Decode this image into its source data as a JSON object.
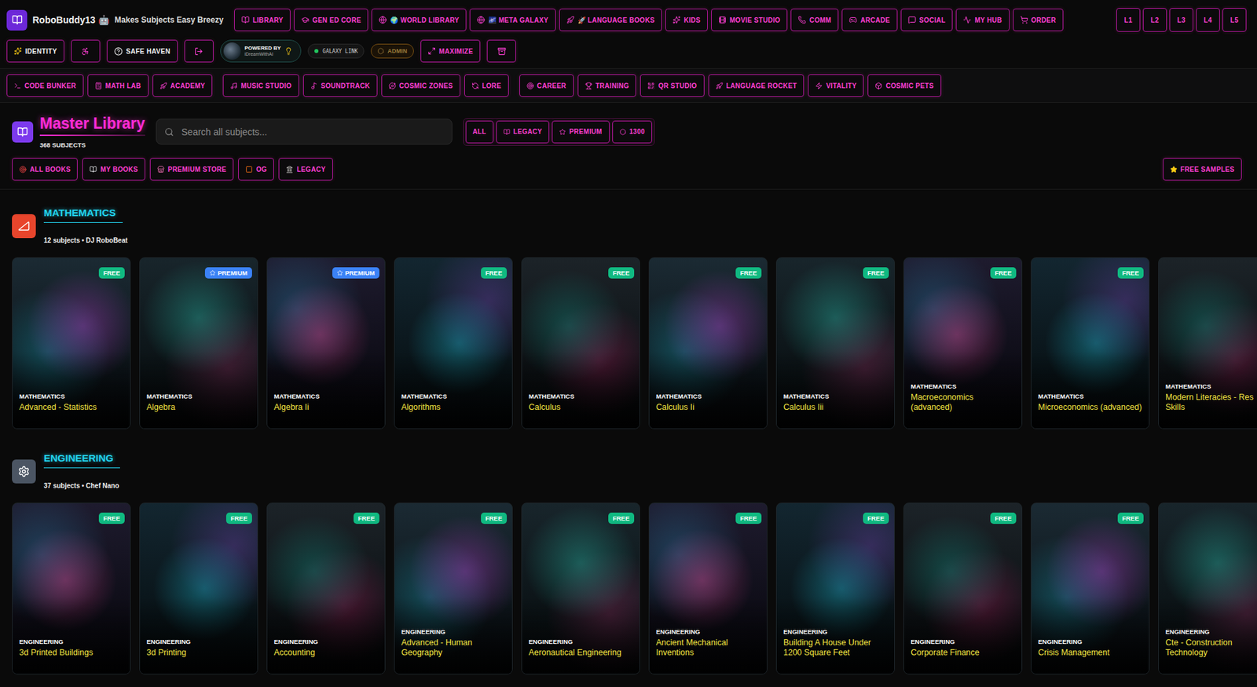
{
  "header": {
    "brand": "RoboBuddy13 🤖",
    "tagline": "Makes Subjects Easy Breezy",
    "nav": [
      {
        "label": "LIBRARY",
        "selected": false
      },
      {
        "label": "GEN ED CORE",
        "selected": false
      },
      {
        "label": "🌍 WORLD LIBRARY",
        "selected": false
      },
      {
        "label": "🌌 META GALAXY",
        "selected": false
      },
      {
        "label": "🚀 LANGUAGE BOOKS",
        "selected": false
      },
      {
        "label": "KIDS",
        "selected": false
      },
      {
        "label": "MOVIE STUDIO",
        "selected": false
      },
      {
        "label": "COMM",
        "selected": false
      },
      {
        "label": "ARCADE",
        "selected": false
      },
      {
        "label": "SOCIAL",
        "selected": false
      },
      {
        "label": "MY HUB",
        "selected": false
      },
      {
        "label": "ORDER",
        "selected": false
      }
    ],
    "levels": [
      "L1",
      "L2",
      "L3",
      "L4",
      "L5"
    ]
  },
  "toolbar": {
    "identity": "IDENTITY",
    "safe_haven": "SAFE HAVEN",
    "powered_by": "POWERED BY",
    "powered_name": "iDreamWithAI",
    "galaxy_link": "GALAXY LINK",
    "admin": {
      "label": "ADMIN",
      "disabled": true
    },
    "maximize": "MAXIMIZE"
  },
  "tools": [
    [
      "CODE BUNKER",
      "MATH LAB",
      "ACADEMY"
    ],
    [
      "MUSIC STUDIO",
      "SOUNDTRACK",
      "COSMIC ZONES",
      "LORE"
    ],
    [
      "CAREER",
      "TRAINING",
      "QR STUDIO",
      "LANGUAGE ROCKET",
      "VITALITY",
      "COSMIC PETS"
    ]
  ],
  "library": {
    "title": "Master Library",
    "count": "368 SUBJECTS",
    "search_placeholder": "Search all subjects...",
    "filters": [
      {
        "label": "ALL",
        "selected": false
      },
      {
        "label": "LEGACY",
        "selected": false
      },
      {
        "label": "PREMIUM",
        "selected": false
      },
      {
        "label": "1300",
        "selected": false
      }
    ],
    "book_tabs": [
      {
        "label": "ALL BOOKS",
        "selected": false
      },
      {
        "label": "MY BOOKS",
        "selected": false
      },
      {
        "label": "PREMIUM STORE",
        "selected": false
      },
      {
        "label": "OG",
        "selected": false
      },
      {
        "label": "LEGACY",
        "selected": false
      }
    ],
    "free_samples": "FREE SAMPLES"
  },
  "sections": [
    {
      "title": "MATHEMATICS",
      "meta": "12 subjects • DJ RoboBeat",
      "color": "#e8452c",
      "cards": [
        {
          "category": "MATHEMATICS",
          "title": "Advanced - Statistics",
          "badge": {
            "label": "FREE",
            "kind": "free",
            "color": "#10b981"
          }
        },
        {
          "category": "MATHEMATICS",
          "title": "Algebra",
          "badge": {
            "label": "PREMIUM",
            "kind": "premium",
            "color": "#3b82f6"
          }
        },
        {
          "category": "MATHEMATICS",
          "title": "Algebra Ii",
          "badge": {
            "label": "PREMIUM",
            "kind": "premium",
            "color": "#3b82f6"
          }
        },
        {
          "category": "MATHEMATICS",
          "title": "Algorithms",
          "badge": {
            "label": "FREE",
            "kind": "free",
            "color": "#10b981"
          }
        },
        {
          "category": "MATHEMATICS",
          "title": "Calculus",
          "badge": {
            "label": "FREE",
            "kind": "free",
            "color": "#10b981"
          }
        },
        {
          "category": "MATHEMATICS",
          "title": "Calculus Ii",
          "badge": {
            "label": "FREE",
            "kind": "free",
            "color": "#10b981"
          }
        },
        {
          "category": "MATHEMATICS",
          "title": "Calculus Iii",
          "badge": {
            "label": "FREE",
            "kind": "free",
            "color": "#10b981"
          }
        },
        {
          "category": "MATHEMATICS",
          "title": "Macroeconomics (advanced)",
          "badge": {
            "label": "FREE",
            "kind": "free",
            "color": "#10b981"
          }
        },
        {
          "category": "MATHEMATICS",
          "title": "Microeconomics (advanced)",
          "badge": {
            "label": "FREE",
            "kind": "free",
            "color": "#10b981"
          }
        },
        {
          "category": "MATHEMATICS",
          "title": "Modern Literacies - Res Skills",
          "badge": null
        }
      ]
    },
    {
      "title": "ENGINEERING",
      "meta": "37 subjects • Chef Nano",
      "color": "#4b5563",
      "cards": [
        {
          "category": "ENGINEERING",
          "title": "3d Printed Buildings",
          "badge": {
            "label": "FREE",
            "kind": "free",
            "color": "#10b981"
          }
        },
        {
          "category": "ENGINEERING",
          "title": "3d Printing",
          "badge": {
            "label": "FREE",
            "kind": "free",
            "color": "#10b981"
          }
        },
        {
          "category": "ENGINEERING",
          "title": "Accounting",
          "badge": {
            "label": "FREE",
            "kind": "free",
            "color": "#10b981"
          }
        },
        {
          "category": "ENGINEERING",
          "title": "Advanced - Human Geography",
          "badge": {
            "label": "FREE",
            "kind": "free",
            "color": "#10b981"
          }
        },
        {
          "category": "ENGINEERING",
          "title": "Aeronautical Engineering",
          "badge": {
            "label": "FREE",
            "kind": "free",
            "color": "#10b981"
          }
        },
        {
          "category": "ENGINEERING",
          "title": "Ancient Mechanical Inventions",
          "badge": {
            "label": "FREE",
            "kind": "free",
            "color": "#10b981"
          }
        },
        {
          "category": "ENGINEERING",
          "title": "Building A House Under 1200 Square Feet",
          "badge": {
            "label": "FREE",
            "kind": "free",
            "color": "#10b981"
          }
        },
        {
          "category": "ENGINEERING",
          "title": "Corporate Finance",
          "badge": {
            "label": "FREE",
            "kind": "free",
            "color": "#10b981"
          }
        },
        {
          "category": "ENGINEERING",
          "title": "Crisis Management",
          "badge": {
            "label": "FREE",
            "kind": "free",
            "color": "#10b981"
          }
        },
        {
          "category": "ENGINEERING",
          "title": "Cte - Construction Technology",
          "badge": null
        }
      ]
    }
  ]
}
